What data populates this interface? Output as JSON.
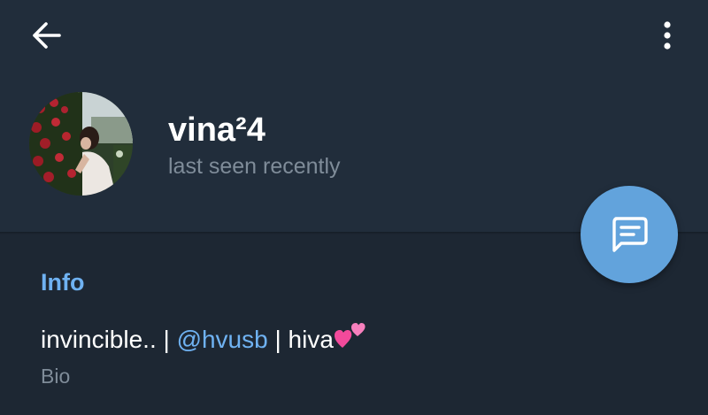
{
  "colors": {
    "header_bg": "#212d3b",
    "page_bg": "#1d2733",
    "accent": "#6fb2f2",
    "fab": "#62a3dc",
    "secondary_text": "#7f8c99"
  },
  "header": {
    "back_icon": "arrow-left-icon",
    "menu_icon": "more-vertical-icon"
  },
  "profile": {
    "name": "vina²4",
    "status": "last seen recently"
  },
  "fab": {
    "icon": "message-icon"
  },
  "info": {
    "title": "Info",
    "bio_before": "invincible.. | ",
    "bio_link": "@hvusb",
    "bio_after": " | hiva",
    "bio_emoji": "two-hearts-emoji",
    "bio_label": "Bio"
  }
}
